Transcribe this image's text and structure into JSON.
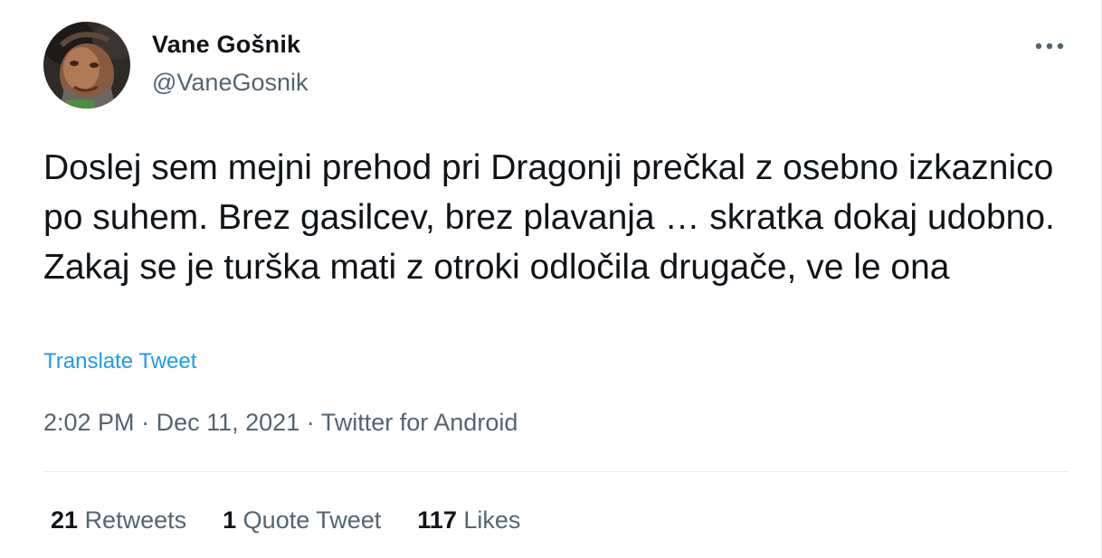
{
  "author": {
    "name": "Vane Gošnik",
    "handle": "@VaneGosnik"
  },
  "tweet": {
    "text": "Doslej sem mejni prehod pri Dragonji prečkal z osebno izkaznico po suhem. Brez gasilcev, brez plavanja … skratka dokaj udobno. Zakaj se je turška mati z otroki odločila drugače, ve le ona",
    "translate_label": "Translate Tweet",
    "time": "2:02 PM",
    "separator": "·",
    "date": "Dec 11, 2021",
    "source": "Twitter for Android"
  },
  "stats": {
    "retweets_count": "21",
    "retweets_label": "Retweets",
    "quotes_count": "1",
    "quotes_label": "Quote Tweet",
    "likes_count": "117",
    "likes_label": "Likes"
  },
  "icons": {
    "more": "more-horizontal-icon"
  },
  "colors": {
    "text": "#0f1419",
    "secondary": "#536471",
    "link": "#1d9bf0",
    "divider": "#e6ecf0"
  }
}
